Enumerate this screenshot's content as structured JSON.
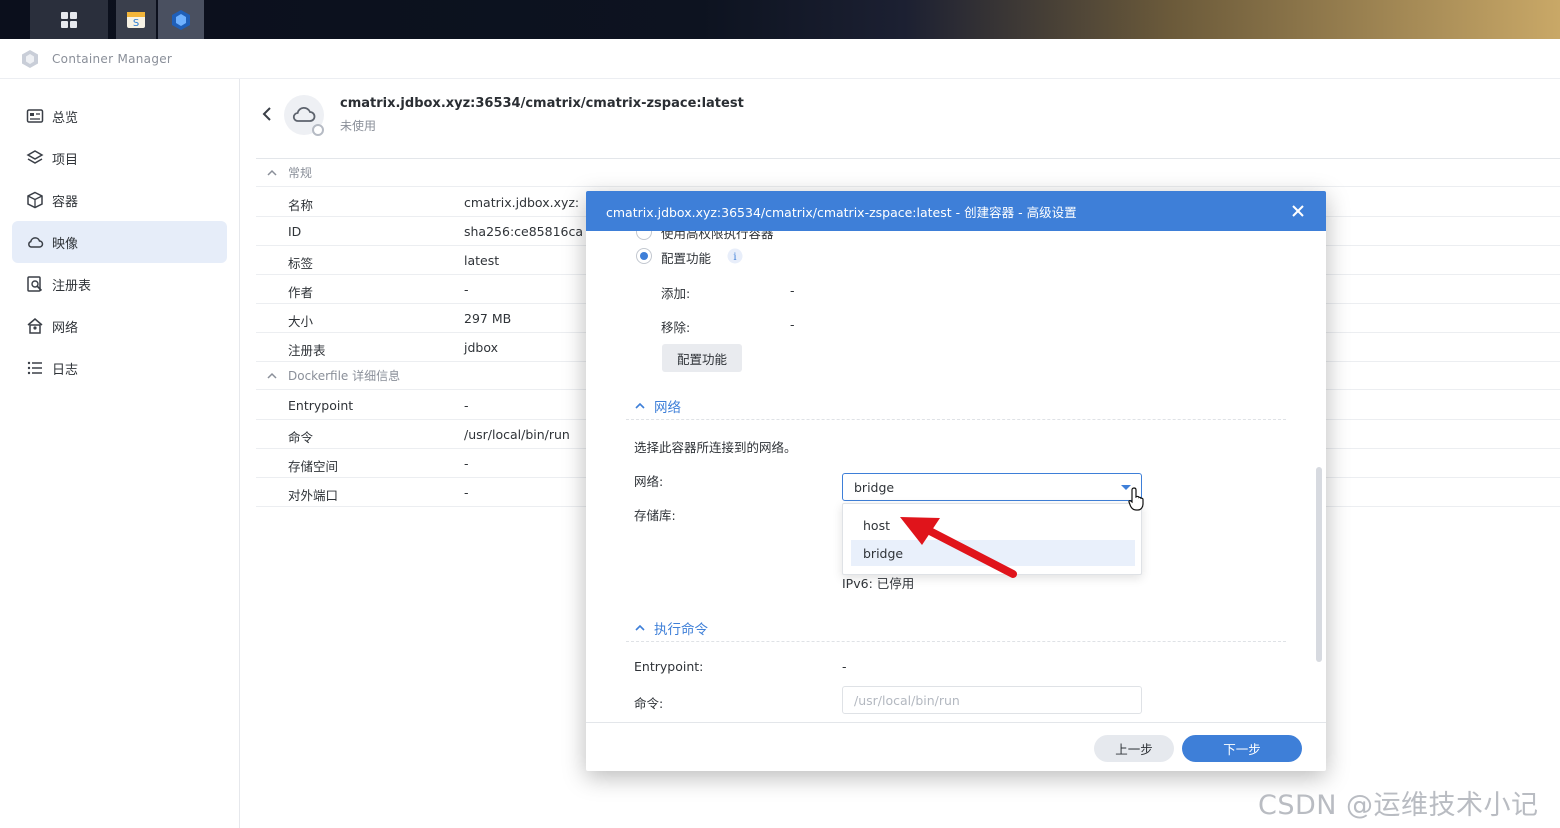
{
  "app": {
    "title": "Container Manager"
  },
  "sidebar": {
    "items": [
      {
        "label": "总览",
        "icon": "overview-icon"
      },
      {
        "label": "项目",
        "icon": "layers-icon"
      },
      {
        "label": "容器",
        "icon": "cube-icon"
      },
      {
        "label": "映像",
        "icon": "cloud-icon",
        "active": true
      },
      {
        "label": "注册表",
        "icon": "registry-search-icon"
      },
      {
        "label": "网络",
        "icon": "network-house-icon"
      },
      {
        "label": "日志",
        "icon": "list-icon"
      }
    ]
  },
  "image": {
    "name": "cmatrix.jdbox.xyz:36534/cmatrix/cmatrix-zspace:latest",
    "status": "未使用"
  },
  "general": {
    "heading": "常规",
    "rows": [
      {
        "key": "名称",
        "value": "cmatrix.jdbox.xyz:"
      },
      {
        "key": "ID",
        "value": "sha256:ce85816ca"
      },
      {
        "key": "标签",
        "value": "latest"
      },
      {
        "key": "作者",
        "value": "-"
      },
      {
        "key": "大小",
        "value": "297 MB"
      },
      {
        "key": "注册表",
        "value": "jdbox"
      }
    ]
  },
  "dockerfile": {
    "heading": "Dockerfile 详细信息",
    "rows": [
      {
        "key": "Entrypoint",
        "value": "-"
      },
      {
        "key": "命令",
        "value": "/usr/local/bin/run"
      },
      {
        "key": "存储空间",
        "value": "-"
      },
      {
        "key": "对外端口",
        "value": "-"
      }
    ]
  },
  "modal": {
    "title": "cmatrix.jdbox.xyz:36534/cmatrix/cmatrix-zspace:latest - 创建容器 - 高级设置",
    "privileged_label": "使用高权限执行容器",
    "capabilities_label": "配置功能",
    "add_label": "添加:",
    "add_value": "-",
    "remove_label": "移除:",
    "remove_value": "-",
    "capabilities_button": "配置功能",
    "network_heading": "网络",
    "network_desc": "选择此容器所连接到的网络。",
    "network_label": "网络:",
    "network_value": "bridge",
    "network_options": [
      "host",
      "bridge"
    ],
    "storage_label": "存储库:",
    "ipv6_text": "IPv6: 已停用",
    "exec_heading": "执行命令",
    "entrypoint_label": "Entrypoint:",
    "entrypoint_value": "-",
    "command_label": "命令:",
    "command_placeholder": "/usr/local/bin/run",
    "prev_button": "上一步",
    "next_button": "下一步"
  },
  "watermark": "CSDN @运维技术小记",
  "colors": {
    "accent": "#3e7fd8",
    "annotation_arrow": "#e0141b"
  }
}
